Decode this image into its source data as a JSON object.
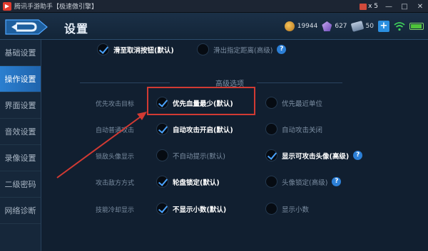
{
  "titlebar": {
    "title": "腾讯手游助手【极速傲引擎】",
    "gift_count": "x 5",
    "minimize": "—",
    "maximize": "□",
    "close": "✕"
  },
  "header": {
    "title": "设置",
    "coins": "19944",
    "gems": "627",
    "tickets": "50",
    "plus": "+"
  },
  "sidebar": {
    "items": [
      {
        "label": "基础设置",
        "active": false
      },
      {
        "label": "操作设置",
        "active": true
      },
      {
        "label": "界面设置",
        "active": false
      },
      {
        "label": "音效设置",
        "active": false
      },
      {
        "label": "录像设置",
        "active": false
      },
      {
        "label": "二级密码",
        "active": false
      },
      {
        "label": "网络诊断",
        "active": false
      }
    ]
  },
  "top_row": {
    "opt1": "滑至取消按钮(默认)",
    "opt2": "滑出指定距离(高级)"
  },
  "section_title": "高级选项",
  "rows": [
    {
      "label": "优先攻击目标",
      "left": "优先血量最少(默认)",
      "right": "优先最近单位"
    },
    {
      "label": "自动普通攻击",
      "left": "自动攻击开启(默认)",
      "right": "自动攻击关闭"
    },
    {
      "label": "锁敌头像显示",
      "left": "不自动提示(默认)",
      "right": "显示可攻击头像(高级)"
    },
    {
      "label": "攻击敌方方式",
      "left": "轮盘锁定(默认)",
      "right": "头像锁定(高级)"
    },
    {
      "label": "技能冷却显示",
      "left": "不显示小数(默认)",
      "right": "显示小数"
    }
  ],
  "colors": {
    "accent": "#2b7fd0",
    "annotation": "#d23a33",
    "check": "#4aa3ff"
  }
}
